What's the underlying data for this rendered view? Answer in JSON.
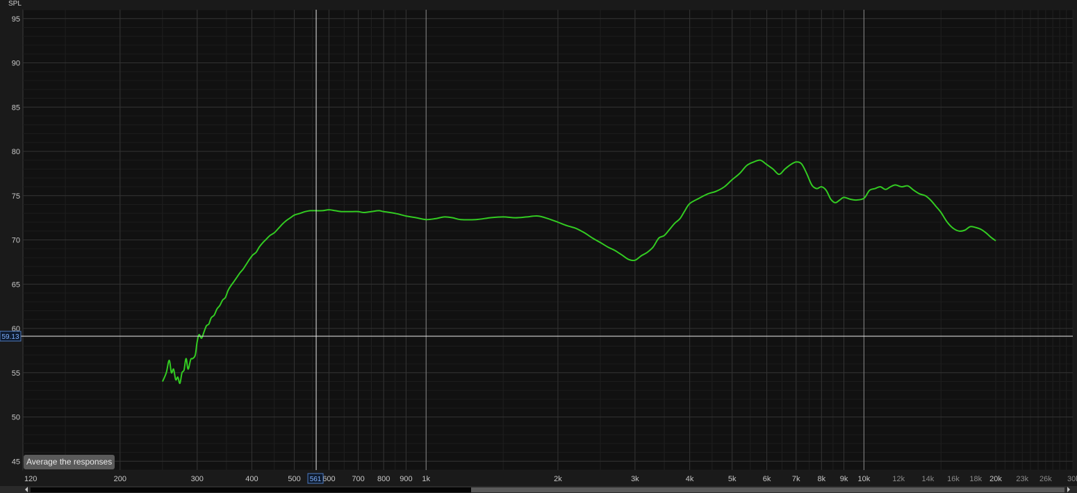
{
  "chart_data": {
    "type": "line",
    "ylabel": "SPL",
    "ylim": [
      44,
      96
    ],
    "xlim": [
      120,
      30000
    ],
    "xscale": "log",
    "grid": true,
    "y_ticks": [
      95,
      90,
      85,
      80,
      75,
      70,
      65,
      60,
      55,
      50,
      45
    ],
    "x_ticks": [
      {
        "value": 120,
        "label": "120"
      },
      {
        "value": 200,
        "label": "200"
      },
      {
        "value": 300,
        "label": "300"
      },
      {
        "value": 400,
        "label": "400"
      },
      {
        "value": 500,
        "label": "500"
      },
      {
        "value": 600,
        "label": "600"
      },
      {
        "value": 700,
        "label": "700"
      },
      {
        "value": 800,
        "label": "800"
      },
      {
        "value": 900,
        "label": "900"
      },
      {
        "value": 1000,
        "label": "1k"
      },
      {
        "value": 2000,
        "label": "2k"
      },
      {
        "value": 3000,
        "label": "3k"
      },
      {
        "value": 4000,
        "label": "4k"
      },
      {
        "value": 5000,
        "label": "5k"
      },
      {
        "value": 6000,
        "label": "6k"
      },
      {
        "value": 7000,
        "label": "7k"
      },
      {
        "value": 8000,
        "label": "8k"
      },
      {
        "value": 9000,
        "label": "9k"
      },
      {
        "value": 10000,
        "label": "10k"
      },
      {
        "value": 12000,
        "label": "12k"
      },
      {
        "value": 14000,
        "label": "14k"
      },
      {
        "value": 16000,
        "label": "16k"
      },
      {
        "value": 18000,
        "label": "18k"
      },
      {
        "value": 20000,
        "label": "20k"
      },
      {
        "value": 23000,
        "label": "23k"
      },
      {
        "value": 26000,
        "label": "26k"
      },
      {
        "value": 30000,
        "label": "30kHz"
      }
    ],
    "cursor": {
      "x": 561,
      "x_label": "561",
      "y": 59.13,
      "y_label": "59.13"
    },
    "series": [
      {
        "color": "#33cc22",
        "x": [
          250,
          255,
          259,
          262,
          265,
          268,
          271,
          274,
          277,
          280,
          283,
          286,
          290,
          293,
          297,
          300,
          303,
          307,
          311,
          315,
          319,
          323,
          328,
          333,
          338,
          343,
          348,
          353,
          358,
          364,
          370,
          376,
          382,
          388,
          395,
          402,
          409,
          416,
          424,
          432,
          440,
          450,
          460,
          470,
          480,
          490,
          500,
          515,
          530,
          545,
          560,
          580,
          600,
          620,
          640,
          660,
          680,
          700,
          720,
          750,
          780,
          800,
          850,
          900,
          950,
          1000,
          1050,
          1100,
          1150,
          1200,
          1300,
          1400,
          1500,
          1600,
          1700,
          1800,
          1900,
          2000,
          2100,
          2200,
          2300,
          2400,
          2500,
          2600,
          2700,
          2800,
          2900,
          3000,
          3100,
          3200,
          3300,
          3400,
          3500,
          3600,
          3700,
          3800,
          3900,
          4000,
          4200,
          4400,
          4600,
          4800,
          5000,
          5200,
          5400,
          5600,
          5800,
          6000,
          6200,
          6400,
          6600,
          6800,
          7000,
          7200,
          7400,
          7600,
          7800,
          8000,
          8200,
          8400,
          8600,
          8800,
          9000,
          9300,
          9600,
          10000,
          10300,
          10600,
          10900,
          11200,
          11500,
          11800,
          12200,
          12600,
          13000,
          13400,
          13800,
          14200,
          14600,
          15000,
          15500,
          16000,
          16500,
          17000,
          17500,
          18000,
          18500,
          19000,
          19500,
          20000
        ],
        "y": [
          54.0,
          55.0,
          56.4,
          55.0,
          55.4,
          54.2,
          54.5,
          53.8,
          55.0,
          55.3,
          56.6,
          55.4,
          56.5,
          56.6,
          57.0,
          58.5,
          59.3,
          58.9,
          59.6,
          60.3,
          60.5,
          61.2,
          61.5,
          62.2,
          62.6,
          63.2,
          63.5,
          64.3,
          64.8,
          65.3,
          65.8,
          66.3,
          66.7,
          67.2,
          67.8,
          68.3,
          68.6,
          69.2,
          69.7,
          70.1,
          70.5,
          70.8,
          71.3,
          71.8,
          72.2,
          72.5,
          72.8,
          73.0,
          73.2,
          73.3,
          73.3,
          73.3,
          73.4,
          73.3,
          73.2,
          73.2,
          73.2,
          73.2,
          73.1,
          73.2,
          73.3,
          73.2,
          73.0,
          72.7,
          72.5,
          72.3,
          72.4,
          72.6,
          72.5,
          72.3,
          72.3,
          72.5,
          72.6,
          72.5,
          72.6,
          72.7,
          72.4,
          72.0,
          71.6,
          71.3,
          70.8,
          70.2,
          69.7,
          69.2,
          68.8,
          68.3,
          67.8,
          67.7,
          68.2,
          68.6,
          69.2,
          70.2,
          70.5,
          71.2,
          71.9,
          72.4,
          73.3,
          74.1,
          74.7,
          75.2,
          75.5,
          76.0,
          76.8,
          77.5,
          78.4,
          78.8,
          79.0,
          78.5,
          78.0,
          77.4,
          78.0,
          78.5,
          78.8,
          78.6,
          77.5,
          76.2,
          75.8,
          76.0,
          75.6,
          74.6,
          74.2,
          74.5,
          74.8,
          74.6,
          74.5,
          74.7,
          75.6,
          75.8,
          76.0,
          75.7,
          76.0,
          76.2,
          76.0,
          76.1,
          75.6,
          75.2,
          75.0,
          74.5,
          73.8,
          73.1,
          72.0,
          71.3,
          71.0,
          71.1,
          71.5,
          71.4,
          71.2,
          70.8,
          70.3,
          69.9
        ]
      }
    ]
  },
  "ui": {
    "average_button_label": "Average the responses"
  }
}
